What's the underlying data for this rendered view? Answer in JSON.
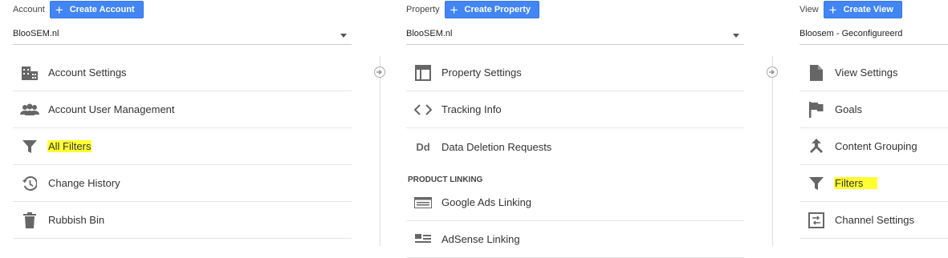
{
  "account": {
    "label": "Account",
    "create_label": "Create Account",
    "selected": "BlooSEM.nl",
    "items": [
      {
        "label": "Account Settings"
      },
      {
        "label": "Account User Management"
      },
      {
        "label": "All Filters"
      },
      {
        "label": "Change History"
      },
      {
        "label": "Rubbish Bin"
      }
    ]
  },
  "property": {
    "label": "Property",
    "create_label": "Create Property",
    "selected": "BlooSEM.nl",
    "items": [
      {
        "label": "Property Settings"
      },
      {
        "label": "Tracking Info"
      },
      {
        "label": "Data Deletion Requests"
      }
    ],
    "section_heading": "PRODUCT LINKING",
    "linking_items": [
      {
        "label": "Google Ads Linking"
      },
      {
        "label": "AdSense Linking"
      }
    ],
    "dd_glyph": "Dd"
  },
  "view": {
    "label": "View",
    "create_label": "Create View",
    "selected": "Bloosem - Geconfigureerd",
    "items": [
      {
        "label": "View Settings"
      },
      {
        "label": "Goals"
      },
      {
        "label": "Content Grouping"
      },
      {
        "label": "Filters"
      },
      {
        "label": "Channel Settings"
      }
    ]
  },
  "colors": {
    "accent": "#4285f4",
    "highlight": "#ffff33",
    "icon": "#666666"
  }
}
